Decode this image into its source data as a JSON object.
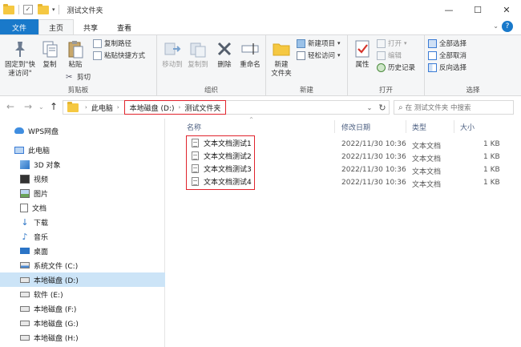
{
  "window": {
    "title": "测试文件夹",
    "controls": [
      "—",
      "☐",
      "✕"
    ]
  },
  "tabs": [
    {
      "label": "文件"
    },
    {
      "label": "主页"
    },
    {
      "label": "共享"
    },
    {
      "label": "查看"
    }
  ],
  "ribbon": {
    "clipboard": {
      "pin_label": "固定到\"快\n速访问\"",
      "copy": "复制",
      "paste": "粘贴",
      "copy_path": "复制路径",
      "paste_shortcut": "粘贴快捷方式",
      "cut": "剪切",
      "group": "剪贴板"
    },
    "organize": {
      "move_to": "移动到",
      "copy_to": "复制到",
      "delete": "删除",
      "rename": "重命名",
      "group": "组织"
    },
    "new": {
      "new_folder": "新建\n文件夹",
      "new_item": "新建项目",
      "easy_access": "轻松访问",
      "group": "新建"
    },
    "open": {
      "properties": "属性",
      "open": "打开",
      "edit": "编辑",
      "history": "历史记录",
      "group": "打开"
    },
    "select": {
      "select_all": "全部选择",
      "select_none": "全部取消",
      "invert": "反向选择",
      "group": "选择"
    }
  },
  "address": {
    "crumbs": [
      "此电脑",
      "本地磁盘 (D:)",
      "测试文件夹"
    ],
    "search_placeholder": "在 测试文件夹 中搜索"
  },
  "nav": [
    {
      "label": "WPS网盘",
      "icon": "cloud-icon"
    },
    {
      "label": "此电脑",
      "icon": "computer-icon"
    },
    {
      "label": "3D 对象",
      "icon": "cube-icon"
    },
    {
      "label": "视频",
      "icon": "video-icon"
    },
    {
      "label": "图片",
      "icon": "picture-icon"
    },
    {
      "label": "文档",
      "icon": "document-icon"
    },
    {
      "label": "下载",
      "icon": "download-icon"
    },
    {
      "label": "音乐",
      "icon": "music-icon"
    },
    {
      "label": "桌面",
      "icon": "desktop-icon"
    },
    {
      "label": "系统文件 (C:)",
      "icon": "drive-icon"
    },
    {
      "label": "本地磁盘 (D:)",
      "icon": "drive-icon",
      "selected": true
    },
    {
      "label": "软件 (E:)",
      "icon": "drive-icon"
    },
    {
      "label": "本地磁盘 (F:)",
      "icon": "drive-icon"
    },
    {
      "label": "本地磁盘 (G:)",
      "icon": "drive-icon"
    },
    {
      "label": "本地磁盘 (H:)",
      "icon": "drive-icon"
    }
  ],
  "columns": {
    "name": "名称",
    "date": "修改日期",
    "type": "类型",
    "size": "大小"
  },
  "files": [
    {
      "name": "文本文档测试1",
      "date": "2022/11/30 10:36",
      "type": "文本文档",
      "size": "1 KB"
    },
    {
      "name": "文本文档测试2",
      "date": "2022/11/30 10:36",
      "type": "文本文档",
      "size": "1 KB"
    },
    {
      "name": "文本文档测试3",
      "date": "2022/11/30 10:36",
      "type": "文本文档",
      "size": "1 KB"
    },
    {
      "name": "文本文档测试4",
      "date": "2022/11/30 10:36",
      "type": "文本文档",
      "size": "1 KB"
    }
  ],
  "colors": {
    "accent": "#1979ca",
    "highlight_box": "#e0242d",
    "selection": "#cce4f7"
  }
}
